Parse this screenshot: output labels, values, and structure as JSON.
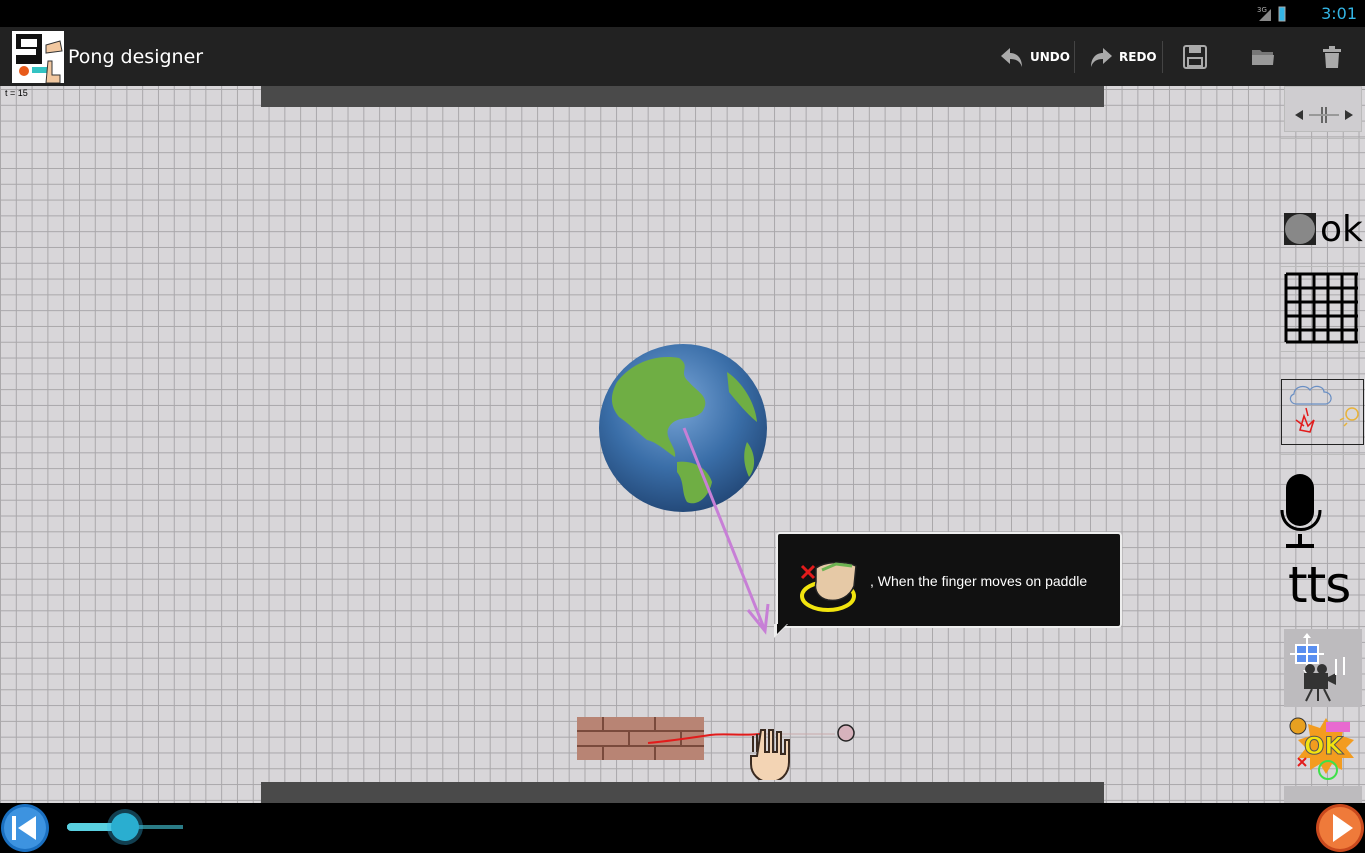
{
  "status_bar": {
    "time": "3:01",
    "network": "3G"
  },
  "action_bar": {
    "title": "Pong designer",
    "undo_label": "UNDO",
    "redo_label": "REDO"
  },
  "canvas": {
    "time_label": "t = 15",
    "tooltip_text": ", When the finger moves on paddle"
  },
  "side_panel": {
    "ok_label": "ok",
    "tts_label": "tts"
  },
  "timeline": {
    "progress": 0.5
  },
  "colors": {
    "accent": "#33b5e5",
    "canvas": "#d8d6d9",
    "wall": "#4a4a4a",
    "arrow": "#c77fd6",
    "trail": "#e21b1b"
  }
}
